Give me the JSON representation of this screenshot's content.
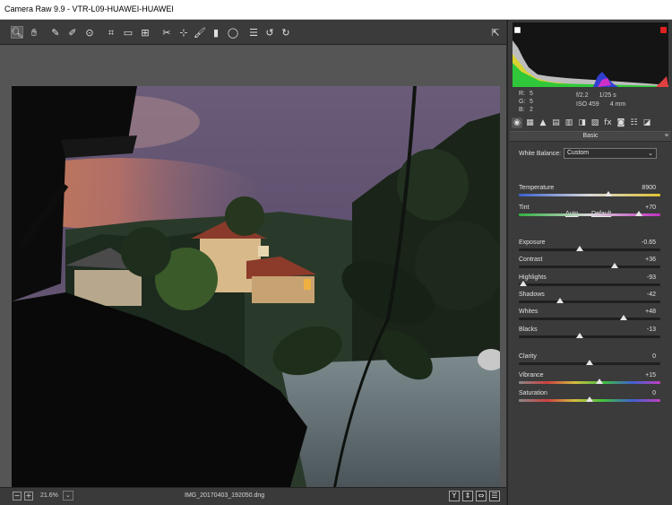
{
  "window": {
    "title": "Camera Raw 9.9  -  VTR-L09-HUAWEI-HUAWEI"
  },
  "toolbar": {
    "tools": [
      {
        "name": "zoom-tool",
        "glyph": "🔍︎",
        "active": true
      },
      {
        "name": "hand-tool",
        "glyph": "✋︎",
        "active": false
      },
      {
        "name": "white-balance-tool",
        "glyph": "✎",
        "active": false
      },
      {
        "name": "color-sampler-tool",
        "glyph": "✐",
        "active": false
      },
      {
        "name": "targeted-adjustment-tool",
        "glyph": "⊙",
        "active": false
      },
      {
        "name": "crop-tool",
        "glyph": "⌗",
        "active": false
      },
      {
        "name": "straighten-tool",
        "glyph": "▭",
        "active": false
      },
      {
        "name": "transform-tool",
        "glyph": "⊞",
        "active": false
      },
      {
        "name": "spot-removal-tool",
        "glyph": "✂",
        "active": false
      },
      {
        "name": "red-eye-tool",
        "glyph": "⊹",
        "active": false
      },
      {
        "name": "adjustment-brush-tool",
        "glyph": "🖌︎",
        "active": false
      },
      {
        "name": "graduated-filter-tool",
        "glyph": "▮",
        "active": false
      },
      {
        "name": "radial-filter-tool",
        "glyph": "◯",
        "active": false
      },
      {
        "name": "preferences-tool",
        "glyph": "☰",
        "active": false
      },
      {
        "name": "rotate-left-tool",
        "glyph": "↺",
        "active": false
      },
      {
        "name": "rotate-right-tool",
        "glyph": "↻",
        "active": false
      }
    ],
    "fullscreen_glyph": "⇱"
  },
  "bottom": {
    "zoom_out": "−",
    "zoom_in": "+",
    "zoom_level": "21.6%",
    "zoom_dropdown": "⌄",
    "filename": "IMG_20170403_192050.dng",
    "view_buttons": [
      "Y",
      "⇕",
      "⇔",
      "☰"
    ]
  },
  "readout": {
    "r_label": "R:",
    "r_value": "5",
    "g_label": "G:",
    "g_value": "5",
    "b_label": "B:",
    "b_value": "2",
    "aperture": "f/2.2",
    "shutter": "1/25 s",
    "iso": "ISO 459",
    "focal": "4 mm"
  },
  "panel_tabs": [
    "◉",
    "▦",
    "▲",
    "▤",
    "▥",
    "◨",
    "▧",
    "fx",
    "◙",
    "☷",
    "◪"
  ],
  "basic": {
    "section_title": "Basic",
    "section_menu": "≡",
    "white_balance_label": "White Balance:",
    "white_balance_value": "Custom",
    "white_balance_chevron": "⌄",
    "auto_label": "Auto",
    "default_label": "Default",
    "sliders": [
      {
        "key": "temperature",
        "label": "Temperature",
        "value": "8900",
        "fraction": 0.63,
        "track": "temperature"
      },
      {
        "key": "tint",
        "label": "Tint",
        "value": "+70",
        "fraction": 0.85,
        "track": "tint"
      },
      {
        "key": "exposure",
        "label": "Exposure",
        "value": "-0.65",
        "fraction": 0.43,
        "track": "gray"
      },
      {
        "key": "contrast",
        "label": "Contrast",
        "value": "+36",
        "fraction": 0.68,
        "track": "gray"
      },
      {
        "key": "highlights",
        "label": "Highlights",
        "value": "-93",
        "fraction": 0.03,
        "track": "gray"
      },
      {
        "key": "shadows",
        "label": "Shadows",
        "value": "-42",
        "fraction": 0.29,
        "track": "gray"
      },
      {
        "key": "whites",
        "label": "Whites",
        "value": "+48",
        "fraction": 0.74,
        "track": "gray"
      },
      {
        "key": "blacks",
        "label": "Blacks",
        "value": "-13",
        "fraction": 0.43,
        "track": "gray"
      },
      {
        "key": "clarity",
        "label": "Clarity",
        "value": "0",
        "fraction": 0.5,
        "track": "gray"
      },
      {
        "key": "vibrance",
        "label": "Vibrance",
        "value": "+15",
        "fraction": 0.57,
        "track": "saturation"
      },
      {
        "key": "saturation",
        "label": "Saturation",
        "value": "0",
        "fraction": 0.5,
        "track": "saturation"
      }
    ]
  },
  "colors": {
    "clip_shadow": "#ffffff",
    "clip_highlight": "#e02020"
  }
}
